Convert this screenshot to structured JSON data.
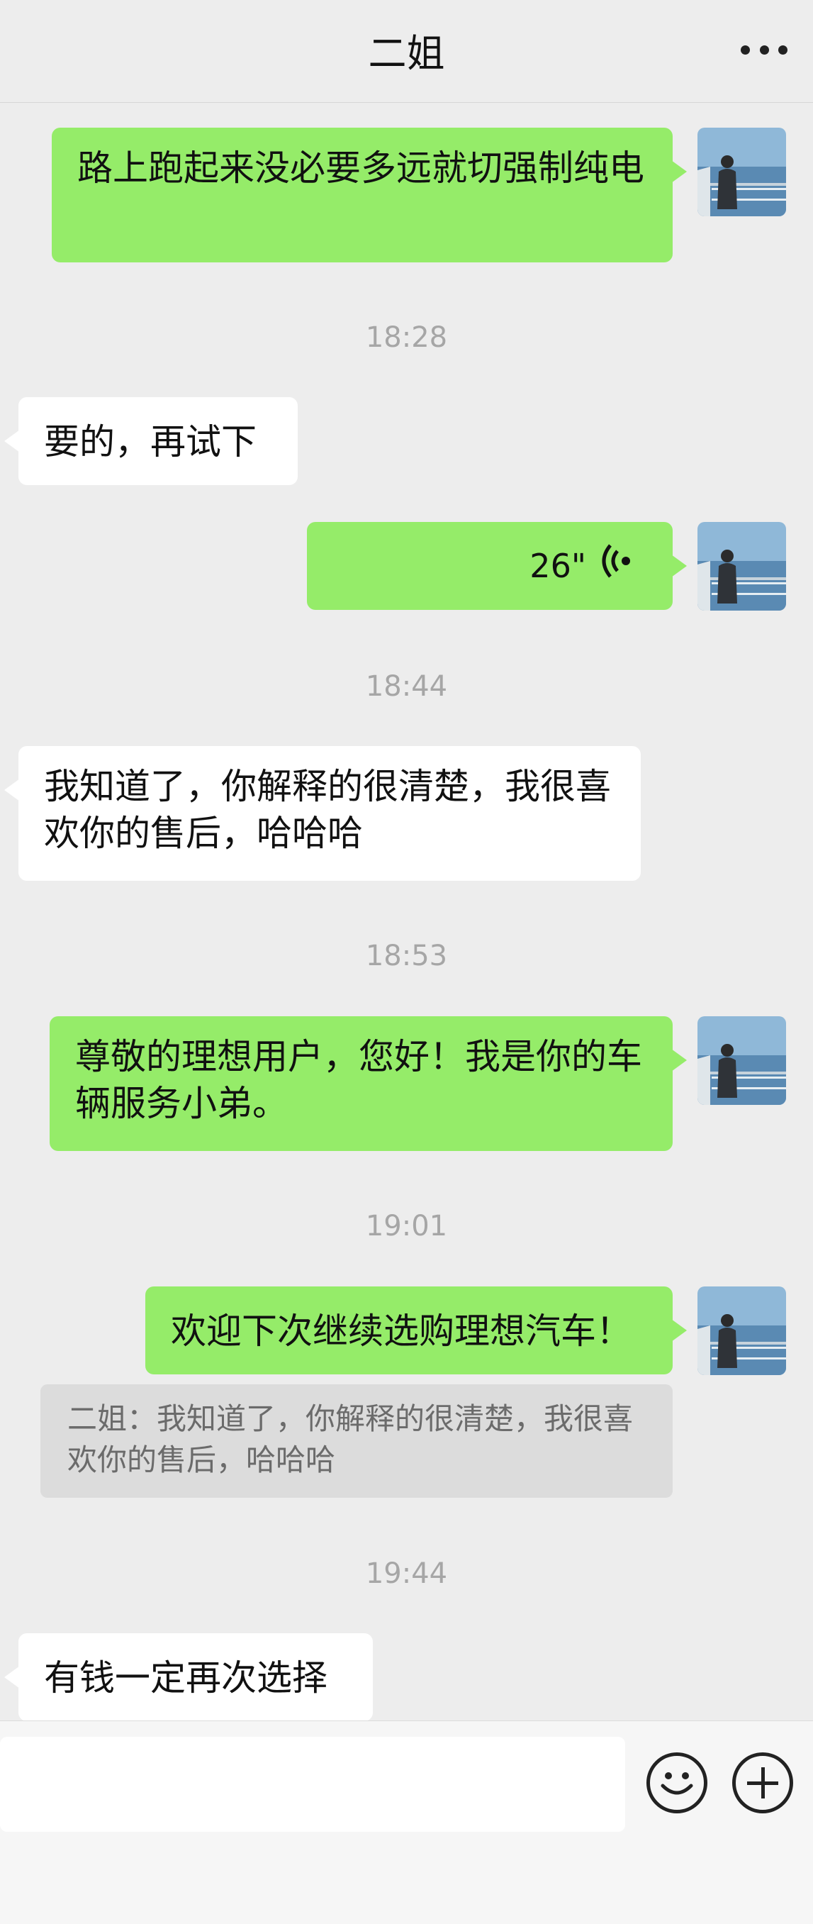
{
  "header": {
    "title": "二姐"
  },
  "messages": {
    "m1": "路上跑起来没必要多远就切强制纯电",
    "t1": "18:28",
    "m2": "要的，再试下",
    "voice_duration": "26\"",
    "t2": "18:44",
    "m3": "我知道了，你解释的很清楚，我很喜欢你的售后，哈哈哈",
    "t3": "18:53",
    "m4": "尊敬的理想用户，您好！我是你的车辆服务小弟。",
    "t4": "19:01",
    "m5": "欢迎下次继续选购理想汽车！",
    "quote": "二姐：我知道了，你解释的很清楚，我很喜欢你的售后，哈哈哈",
    "t5": "19:44",
    "m6": "有钱一定再次选择"
  },
  "colors": {
    "background": "#ededed",
    "sent_bubble": "#95ec69",
    "received_bubble": "#ffffff",
    "timestamp": "#a6a6a6"
  },
  "icons": {
    "more": "more-dots-icon",
    "voice": "voice-wave-icon",
    "emoji": "emoji-icon",
    "plus": "plus-icon"
  }
}
